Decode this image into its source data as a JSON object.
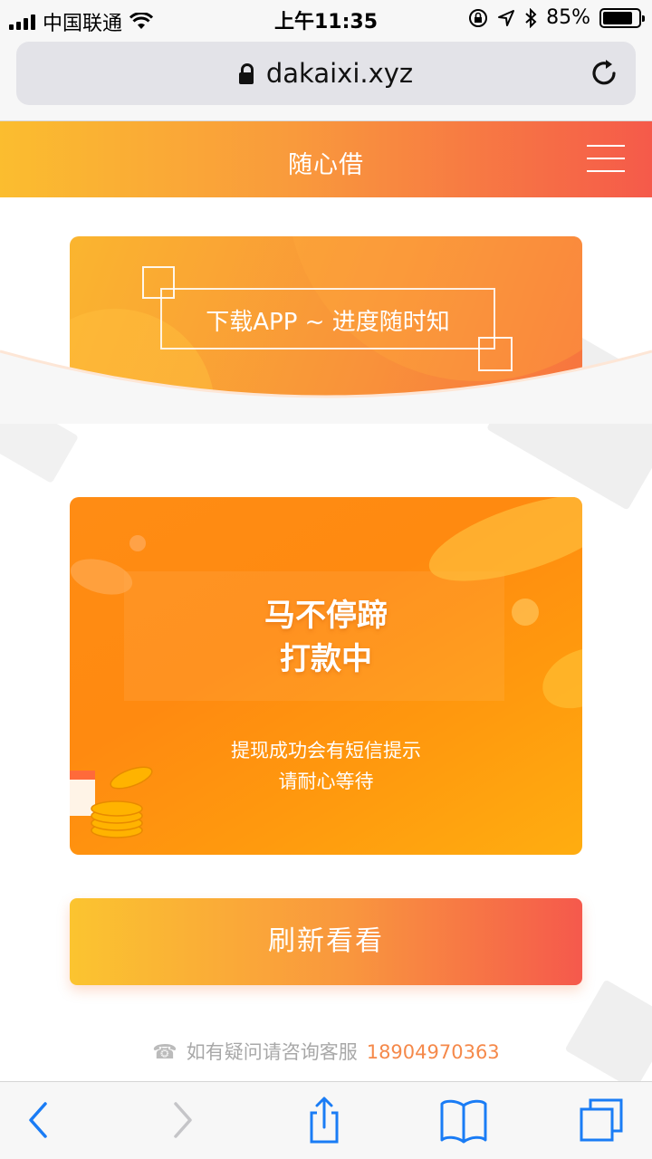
{
  "status_bar": {
    "carrier": "中国联通",
    "time": "上午11:35",
    "battery": "85%"
  },
  "browser": {
    "url": "dakaixi.xyz"
  },
  "header": {
    "title": "随心借"
  },
  "banner": {
    "text": "下载APP ~ 进度随时知"
  },
  "status_card": {
    "title_line1": "马不停蹄",
    "title_line2": "打款中",
    "sub_line1": "提现成功会有短信提示",
    "sub_line2": "请耐心等待"
  },
  "refresh_button": {
    "label": "刷新看看"
  },
  "service": {
    "text": "如有疑问请咨询客服",
    "phone": "18904970363"
  },
  "colors": {
    "accent_orange": "#ff8c14",
    "gradient_start": "#fbc430",
    "gradient_end": "#f5594c",
    "phone_text": "#f5894a",
    "ios_blue": "#1a7cf5"
  },
  "icons": {
    "signal": "signal-icon",
    "wifi": "wifi-icon",
    "lock": "lock-icon",
    "reload": "reload-icon",
    "menu": "hamburger-menu-icon",
    "back": "back-icon",
    "forward": "forward-icon",
    "share": "share-icon",
    "bookmarks": "bookmarks-icon",
    "tabs": "tabs-icon"
  }
}
